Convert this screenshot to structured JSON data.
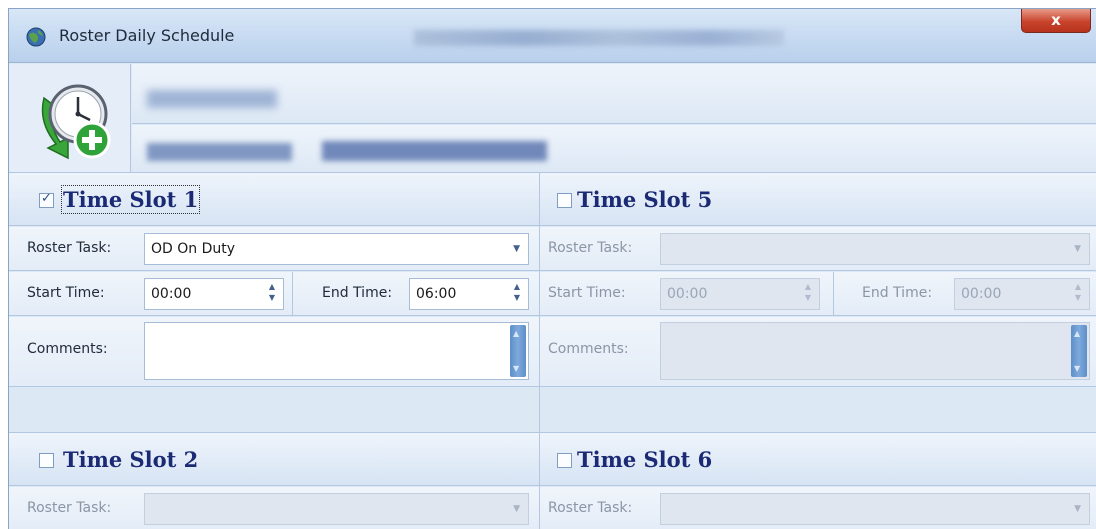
{
  "window": {
    "title": "Roster Daily Schedule",
    "close_glyph": "x",
    "app_icon": "globe-icon",
    "header_icon": "clock-add-icon"
  },
  "slots": [
    {
      "title": "Time Slot 1",
      "checked": true,
      "roster_task_label": "Roster Task:",
      "roster_task_value": "OD On Duty",
      "start_label": "Start Time:",
      "start_value": "00:00",
      "end_label": "End Time:",
      "end_value": "06:00",
      "comments_label": "Comments:"
    },
    {
      "title": "Time Slot 5",
      "checked": false,
      "roster_task_label": "Roster Task:",
      "roster_task_value": "",
      "start_label": "Start Time:",
      "start_value": "00:00",
      "end_label": "End Time:",
      "end_value": "00:00",
      "comments_label": "Comments:"
    },
    {
      "title": "Time Slot 2",
      "checked": false,
      "roster_task_label": "Roster Task:",
      "roster_task_value": ""
    },
    {
      "title": "Time Slot 6",
      "checked": false,
      "roster_task_label": "Roster Task:",
      "roster_task_value": ""
    }
  ],
  "colors": {
    "title_blue": "#1b2a74",
    "panel_bg": "#dde8f5",
    "close_red": "#c9442c"
  }
}
